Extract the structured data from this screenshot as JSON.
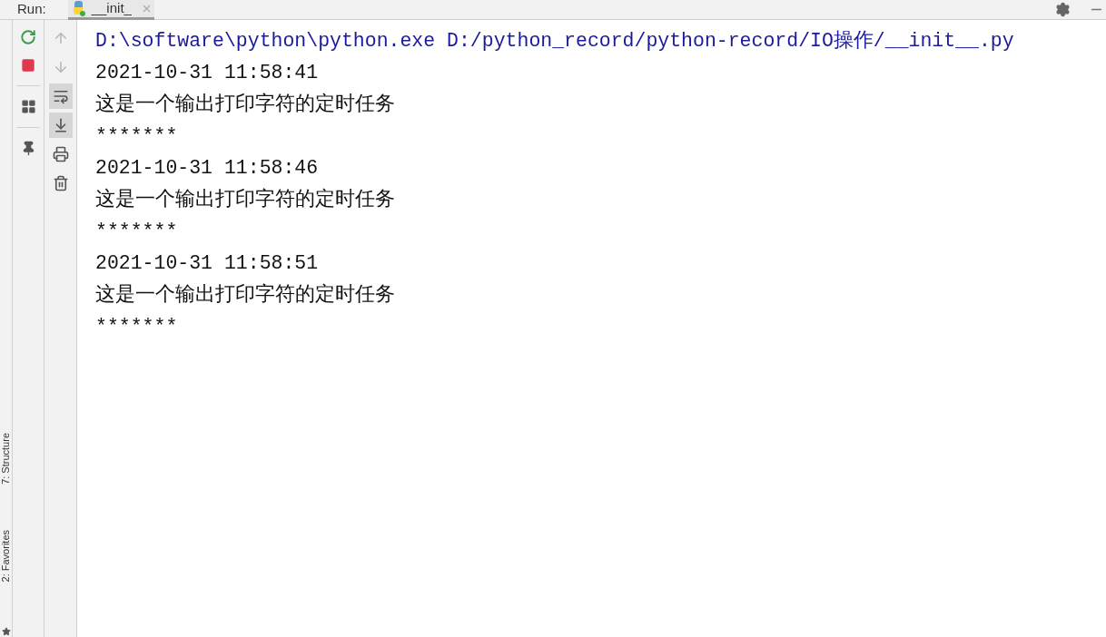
{
  "run_bar": {
    "label": "Run:",
    "tabs": [
      {
        "label": "__init_",
        "selected": true
      }
    ]
  },
  "left_strip": {
    "tabs": [
      {
        "label": "7: Structure"
      },
      {
        "label": "2: Favorites"
      }
    ]
  },
  "run_toolbar": [
    {
      "kind": "rerun"
    },
    {
      "kind": "stop"
    },
    {
      "kind": "layout"
    },
    {
      "kind": "pin"
    }
  ],
  "console_toolbar": [
    {
      "kind": "up",
      "disabled": true,
      "on": false
    },
    {
      "kind": "down",
      "disabled": true,
      "on": false
    },
    {
      "kind": "wrap",
      "disabled": false,
      "on": true
    },
    {
      "kind": "scroll",
      "disabled": false,
      "on": true
    },
    {
      "kind": "print",
      "disabled": false,
      "on": false
    },
    {
      "kind": "trash",
      "disabled": false,
      "on": false
    }
  ],
  "console": [
    {
      "kind": "command",
      "text": "D:\\software\\python\\python.exe D:/python_record/python-record/IO操作/__init__.py"
    },
    {
      "kind": "output",
      "text": "2021-10-31 11:58:41"
    },
    {
      "kind": "output",
      "text": "这是一个输出打印字符的定时任务"
    },
    {
      "kind": "output",
      "text": "*******"
    },
    {
      "kind": "output",
      "text": "2021-10-31 11:58:46"
    },
    {
      "kind": "output",
      "text": "这是一个输出打印字符的定时任务"
    },
    {
      "kind": "output",
      "text": "*******"
    },
    {
      "kind": "output",
      "text": "2021-10-31 11:58:51"
    },
    {
      "kind": "output",
      "text": "这是一个输出打印字符的定时任务"
    },
    {
      "kind": "output",
      "text": "*******"
    }
  ]
}
